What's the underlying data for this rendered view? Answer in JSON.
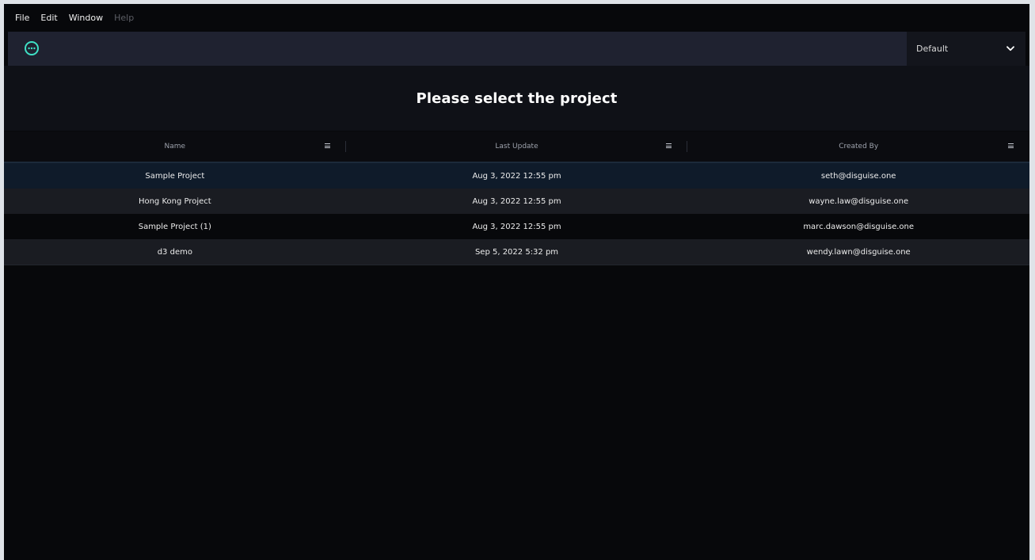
{
  "menubar": {
    "items": [
      {
        "label": "File",
        "enabled": true
      },
      {
        "label": "Edit",
        "enabled": true
      },
      {
        "label": "Window",
        "enabled": true
      },
      {
        "label": "Help",
        "enabled": false
      }
    ]
  },
  "toolbar": {
    "menu_icon": "more-horizontal-circle-icon",
    "accent_color": "#3fe0c5",
    "config_select": {
      "value": "Default",
      "icon": "chevron-down-icon"
    }
  },
  "page": {
    "title": "Please select the project"
  },
  "table": {
    "columns": [
      {
        "label": "Name"
      },
      {
        "label": "Last Update"
      },
      {
        "label": "Created By"
      }
    ],
    "rows": [
      {
        "name": "Sample Project",
        "last_update": "Aug 3, 2022 12:55 pm",
        "created_by": "seth@disguise.one",
        "selected": true
      },
      {
        "name": "Hong Kong Project",
        "last_update": "Aug 3, 2022 12:55 pm",
        "created_by": "wayne.law@disguise.one",
        "selected": false
      },
      {
        "name": "Sample Project (1)",
        "last_update": "Aug 3, 2022 12:55 pm",
        "created_by": "marc.dawson@disguise.one",
        "selected": false
      },
      {
        "name": "d3 demo",
        "last_update": "Sep 5, 2022 5:32 pm",
        "created_by": "wendy.lawn@disguise.one",
        "selected": false
      }
    ]
  }
}
